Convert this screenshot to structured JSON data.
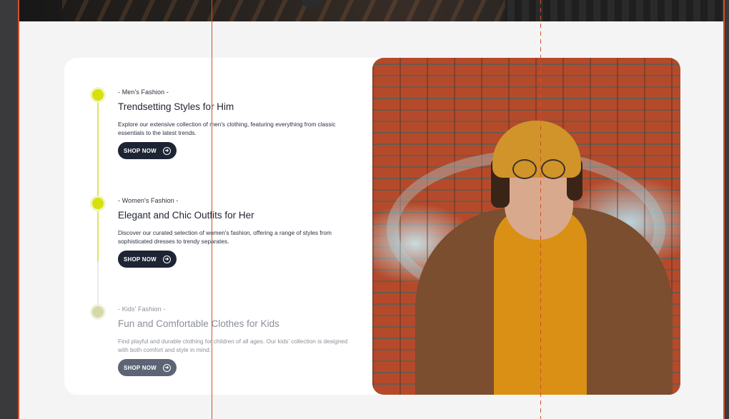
{
  "sections": [
    {
      "eyebrow": "- Men's Fashion -",
      "title": "Trendsetting Styles for Him",
      "description": "Explore our extensive collection of men's clothing, featuring everything from classic essentials to the latest trends.",
      "button_label": "SHOP NOW",
      "state": "active"
    },
    {
      "eyebrow": "- Women's Fashion -",
      "title": "Elegant and Chic Outfits for Her",
      "description": "Discover our curated selection of women's fashion, offering a range of styles from sophisticated dresses to trendy separates.",
      "button_label": "SHOP NOW",
      "state": "active"
    },
    {
      "eyebrow": "- Kids' Fashion -",
      "title": "Fun and Comfortable Clothes for Kids",
      "description": "Find playful and durable clothing for children of all ages. Our kids' collection is designed with both comfort and style in mind.",
      "button_label": "SHOP NOW",
      "state": "inactive"
    }
  ],
  "icons": {
    "button_arrow": "arrow-right-circle-icon"
  },
  "colors": {
    "accent": "#d8e00a",
    "button_bg": "#1d2433",
    "guide_line": "#d4502c",
    "card_bg": "#ffffff",
    "page_bg": "#f4f4f4"
  }
}
